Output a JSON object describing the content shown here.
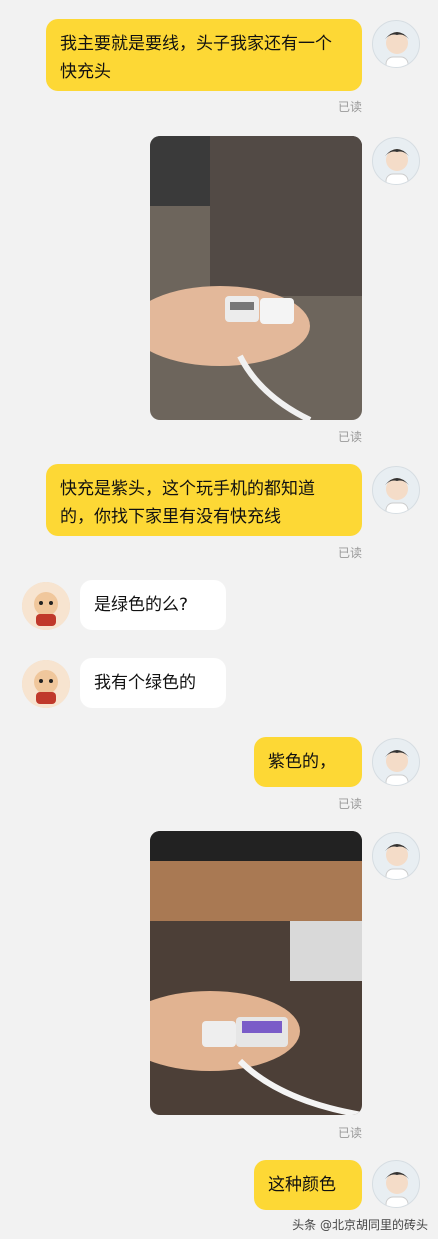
{
  "messages": [
    {
      "from": "me",
      "type": "text",
      "text": "我主要就是要线，头子我家还有一个快充头",
      "read": "已读"
    },
    {
      "from": "me",
      "type": "image",
      "image": "hand holding usb-c cable",
      "read": "已读"
    },
    {
      "from": "me",
      "type": "text",
      "text": "快充是紫头，这个玩手机的都知道的，你找下家里有没有快充线",
      "read": "已读"
    },
    {
      "from": "other",
      "type": "text",
      "text": "是绿色的么?"
    },
    {
      "from": "other",
      "type": "text",
      "text": "我有个绿色的"
    },
    {
      "from": "me",
      "type": "text",
      "text": "紫色的，",
      "read": "已读"
    },
    {
      "from": "me",
      "type": "image",
      "image": "hand holding purple usb cable",
      "read": "已读"
    },
    {
      "from": "me",
      "type": "text",
      "text": "这种颜色"
    }
  ],
  "watermark": "头条 @北京胡同里的砖头",
  "colors": {
    "my_bubble": "#fdd835",
    "their_bubble": "#ffffff",
    "background": "#f2f2f2"
  }
}
